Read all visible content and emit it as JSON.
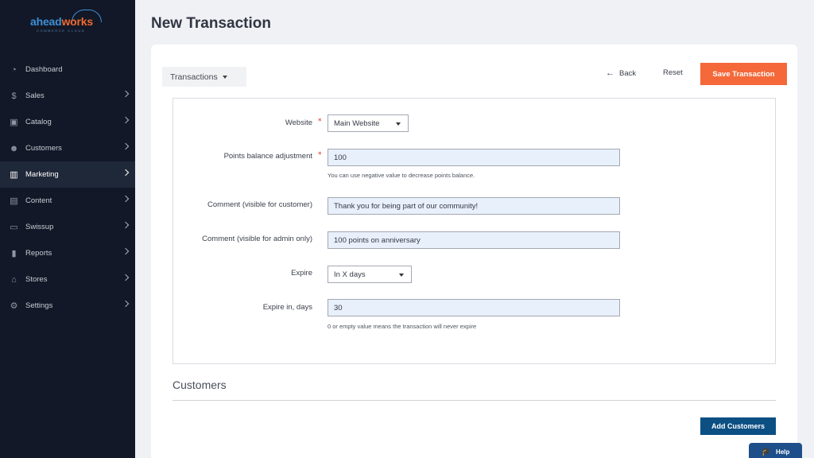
{
  "logo": {
    "brand_a": "ahead",
    "brand_b": "works",
    "tagline": "COMMERCE CLOUD"
  },
  "sidebar": {
    "items": [
      {
        "label": "Dashboard",
        "icon": "dashboard-icon",
        "glyph": "◔",
        "has_children": false,
        "active": false
      },
      {
        "label": "Sales",
        "icon": "dollar-icon",
        "glyph": "$",
        "has_children": true,
        "active": false
      },
      {
        "label": "Catalog",
        "icon": "box-icon",
        "glyph": "▣",
        "has_children": true,
        "active": false
      },
      {
        "label": "Customers",
        "icon": "users-icon",
        "glyph": "☻",
        "has_children": true,
        "active": false
      },
      {
        "label": "Marketing",
        "icon": "bar-chart-icon",
        "glyph": "▥",
        "has_children": true,
        "active": true
      },
      {
        "label": "Content",
        "icon": "layout-icon",
        "glyph": "▤",
        "has_children": true,
        "active": false
      },
      {
        "label": "Swissup",
        "icon": "swissup-icon",
        "glyph": "▭",
        "has_children": true,
        "active": false
      },
      {
        "label": "Reports",
        "icon": "reports-icon",
        "glyph": "▮",
        "has_children": true,
        "active": false
      },
      {
        "label": "Stores",
        "icon": "store-icon",
        "glyph": "⌂",
        "has_children": true,
        "active": false
      },
      {
        "label": "Settings",
        "icon": "gear-icon",
        "glyph": "⚙",
        "has_children": true,
        "active": false
      }
    ]
  },
  "page": {
    "title": "New Transaction"
  },
  "toolbar": {
    "dropdown_label": "Transactions",
    "back_label": "Back",
    "reset_label": "Reset",
    "save_label": "Save Transaction"
  },
  "form": {
    "website": {
      "label": "Website",
      "value": "Main Website"
    },
    "points": {
      "label": "Points balance adjustment",
      "value": "100",
      "note": "You can use negative value to decrease points balance."
    },
    "comment_customer": {
      "label": "Comment (visible for customer)",
      "value": "Thank you for being part of our community!"
    },
    "comment_admin": {
      "label": "Comment (visible for admin only)",
      "value": "100 points on anniversary"
    },
    "expire": {
      "label": "Expire",
      "value": "In X days"
    },
    "expire_days": {
      "label": "Expire in, days",
      "value": "30",
      "note": "0 or empty value means the transaction will never expire"
    }
  },
  "customers": {
    "title": "Customers",
    "add_label": "Add Customers"
  },
  "help": {
    "label": "Help"
  },
  "colors": {
    "sidebar": "#121827",
    "accent_orange": "#f4683a",
    "primary_blue": "#0c4f83"
  }
}
